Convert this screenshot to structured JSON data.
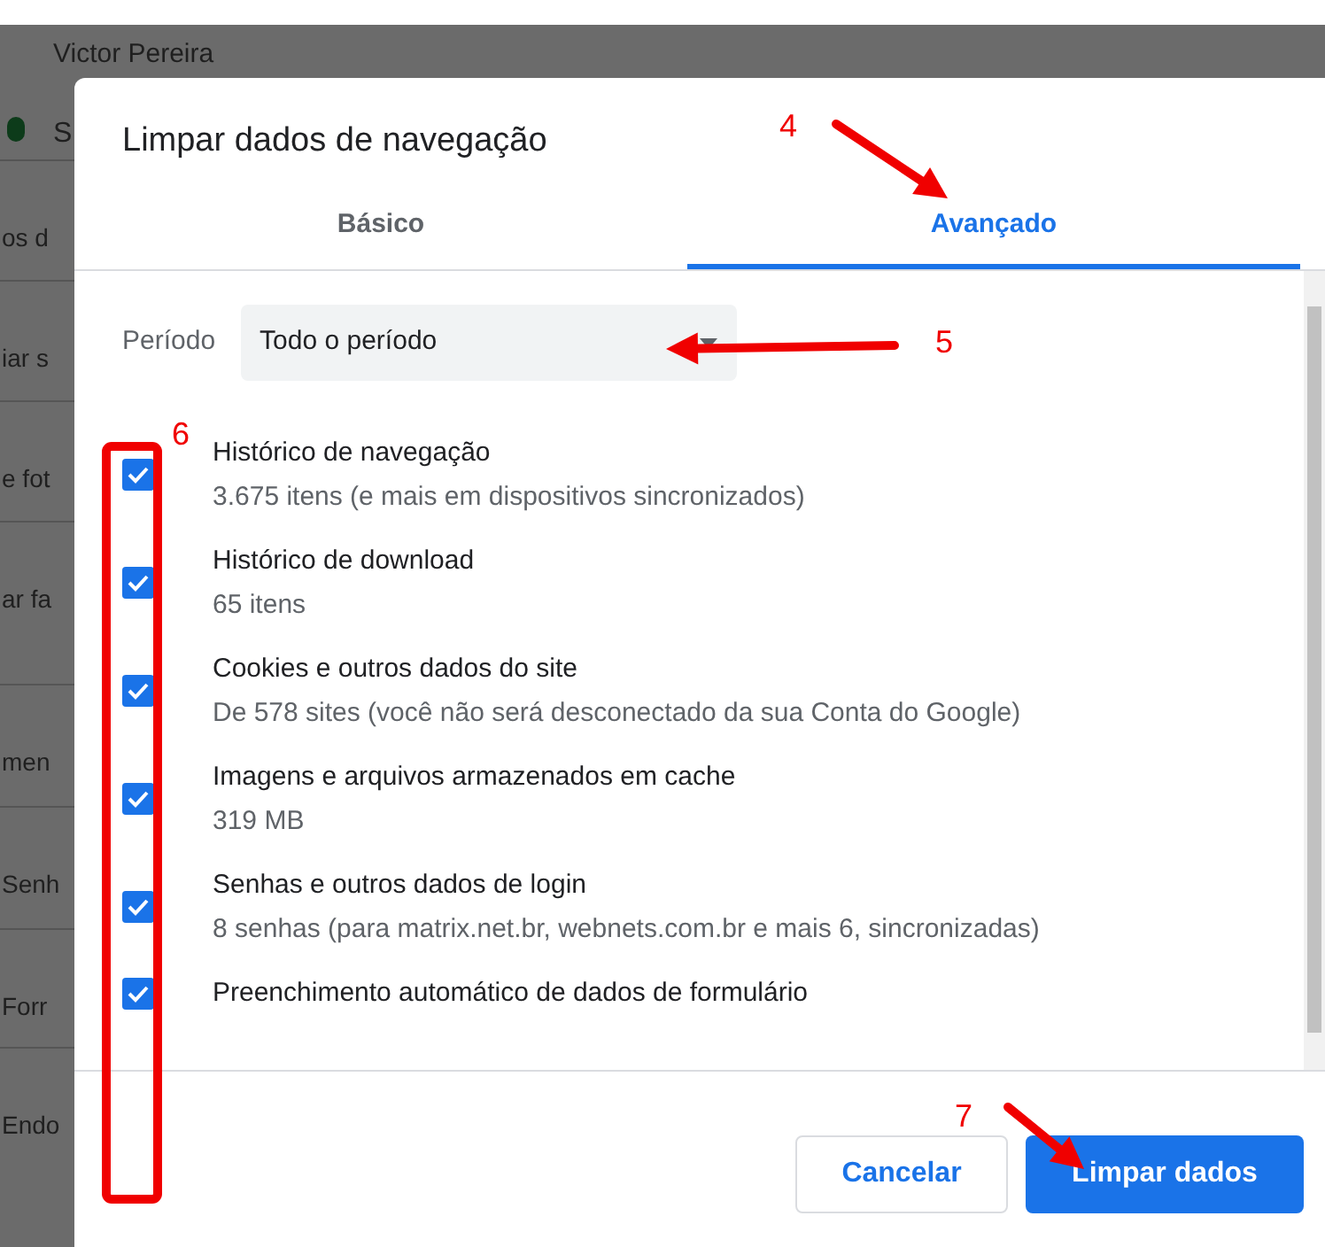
{
  "background": {
    "fragments": [
      "Victor Pereira",
      "S",
      "os d",
      "iar s",
      "e fot",
      "ar fa",
      "men",
      "Senh",
      "Forr",
      "Endo"
    ]
  },
  "dialog": {
    "title": "Limpar dados de navegação",
    "tabs": [
      {
        "label": "Básico",
        "selected": false
      },
      {
        "label": "Avançado",
        "selected": true
      }
    ],
    "period": {
      "label": "Período",
      "value": "Todo o período"
    },
    "items": [
      {
        "title": "Histórico de navegação",
        "description": "3.675 itens (e mais em dispositivos sincronizados)",
        "checked": true
      },
      {
        "title": "Histórico de download",
        "description": "65 itens",
        "checked": true
      },
      {
        "title": "Cookies e outros dados do site",
        "description": "De 578 sites (você não será desconectado da sua Conta do Google)",
        "checked": true
      },
      {
        "title": "Imagens e arquivos armazenados em cache",
        "description": "319 MB",
        "checked": true
      },
      {
        "title": "Senhas e outros dados de login",
        "description": "8 senhas (para matrix.net.br, webnets.com.br e mais 6, sincronizadas)",
        "checked": true
      },
      {
        "title": "Preenchimento automático de dados de formulário",
        "checked": true
      }
    ],
    "buttons": [
      {
        "label": "Cancelar",
        "kind": "secondary"
      },
      {
        "label": "Limpar dados",
        "kind": "primary"
      }
    ]
  },
  "annotations": [
    "4",
    "5",
    "6",
    "7"
  ]
}
